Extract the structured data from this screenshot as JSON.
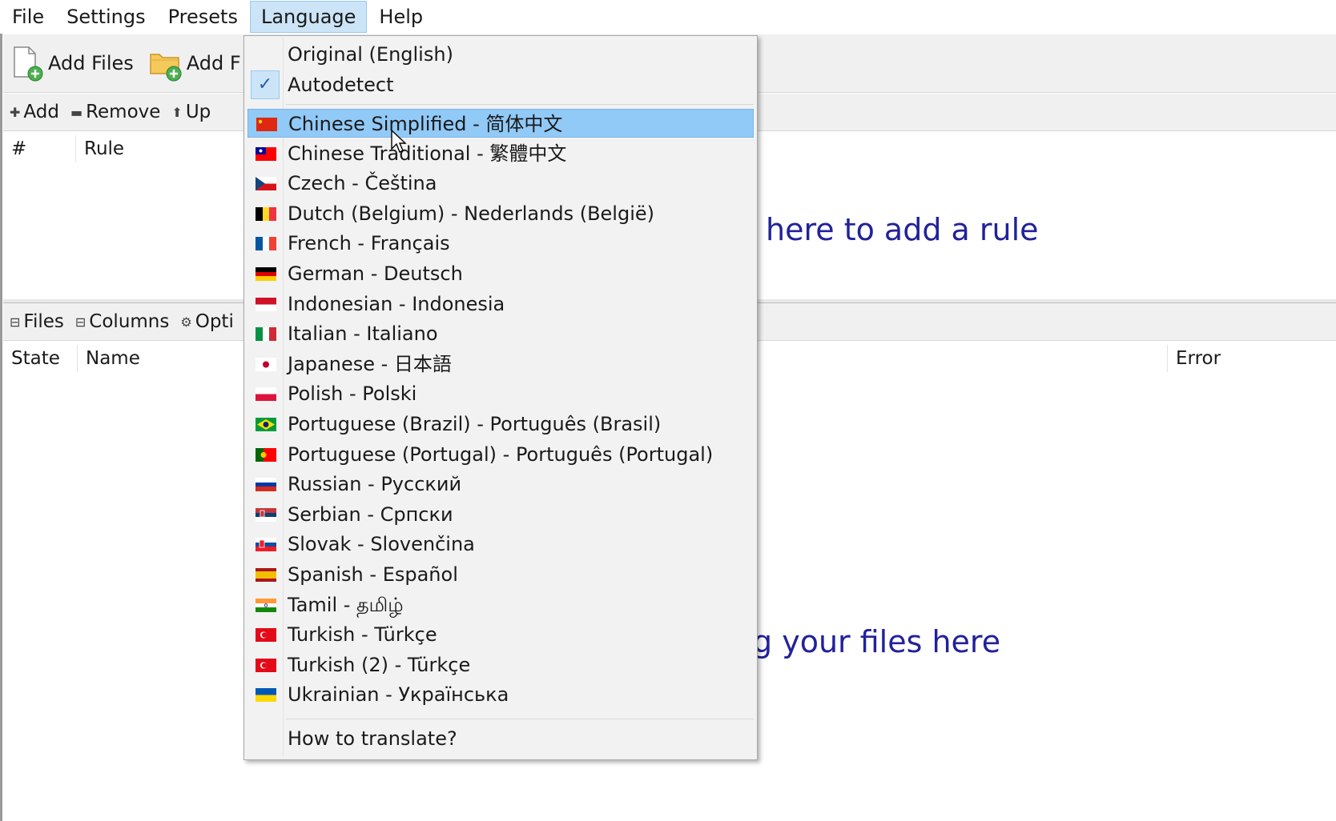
{
  "menubar": [
    "File",
    "Settings",
    "Presets",
    "Language",
    "Help"
  ],
  "toolbar": {
    "add_files": "Add Files",
    "add_folders": "Add F"
  },
  "rules_bar": {
    "add": "Add",
    "remove": "Remove",
    "up": "Up"
  },
  "rules_header": {
    "num": "#",
    "rule": "Rule"
  },
  "rules_hint": "here to add a rule",
  "files_bar": {
    "files": "Files",
    "columns": "Columns",
    "options": "Opti"
  },
  "files_header": {
    "state": "State",
    "name": "Name",
    "error": "Error"
  },
  "files_hint": "g your files here",
  "language_menu": {
    "top": [
      "Original (English)",
      "Autodetect"
    ],
    "languages": [
      "Chinese Simplified - 简体中文",
      "Chinese Traditional - 繁體中文",
      "Czech - Čeština",
      "Dutch (Belgium) - Nederlands (België)",
      "French - Français",
      "German - Deutsch",
      "Indonesian - Indonesia",
      "Italian - Italiano",
      "Japanese - 日本語",
      "Polish - Polski",
      "Portuguese (Brazil) - Português (Brasil)",
      "Portuguese (Portugal) - Português (Portugal)",
      "Russian - Русский",
      "Serbian - Српски",
      "Slovak - Slovenčina",
      "Spanish - Español",
      "Tamil - தமிழ்",
      "Turkish - Türkçe",
      "Turkish (2) - Türkçe",
      "Ukrainian - Українська"
    ],
    "footer": "How to translate?",
    "checked": "Autodetect",
    "highlighted": "Chinese Simplified - 简体中文"
  },
  "colors": {
    "hint_text": "#22229a",
    "highlight": "#91c9f7",
    "menu_bg": "#f2f2f2"
  }
}
